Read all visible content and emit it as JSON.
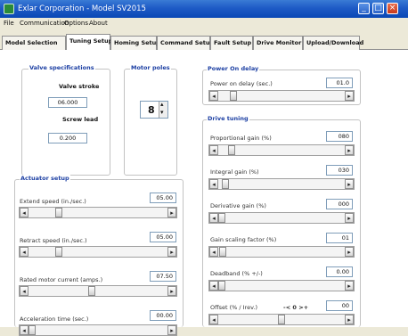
{
  "window": {
    "title": "Exlar Corporation - Model SV2015",
    "min": "_",
    "max": "□",
    "close": "×"
  },
  "menu": [
    "File",
    "Communication",
    "Options",
    "About"
  ],
  "tabs": [
    "Model Selection",
    "Tuning Setup",
    "Homing Setup",
    "Command Setup",
    "Fault Setup",
    "Drive Monitor",
    "Upload/Download"
  ],
  "active_tab": "Tuning Setup",
  "valve_specs": {
    "title": "Valve specifications",
    "stroke_label": "Valve stroke",
    "stroke_value": "06.000",
    "lead_label": "Screw lead",
    "lead_value": "0.200"
  },
  "motor_poles": {
    "title": "Motor poles",
    "value": "8"
  },
  "actuator": {
    "title": "Actuator setup",
    "rows": [
      {
        "label": "Extend speed (in./sec.)",
        "value": "05.00",
        "level": 0.2
      },
      {
        "label": "Retract speed (in./sec.)",
        "value": "05.00",
        "level": 0.2
      },
      {
        "label": "Rated motor current (amps.)",
        "value": "07.50",
        "level": 0.45
      },
      {
        "label": "Acceleration time (sec.)",
        "value": "00.00",
        "level": 0.0
      }
    ]
  },
  "power_on": {
    "title": "Power On delay",
    "label": "Power on delay (sec.)",
    "value": "01.0",
    "level": 0.1
  },
  "drive_tuning": {
    "title": "Drive tuning",
    "rows": [
      {
        "label": "Proportional gain (%)",
        "value": "080",
        "level": 0.08
      },
      {
        "label": "Integral gain (%)",
        "value": "030",
        "level": 0.03
      },
      {
        "label": "Derivative gain (%)",
        "value": "000",
        "level": 0.0
      },
      {
        "label": "Gain scaling factor (%)",
        "value": "01",
        "level": 0.01
      },
      {
        "label": "Deadband (% +/-)",
        "value": "0.00",
        "level": 0.0
      },
      {
        "label": "Offset (% / Irev.)",
        "value": "00",
        "level": 0.5,
        "extra": "-< 0 >+"
      }
    ]
  },
  "icons": {
    "left_arrow": "◂",
    "right_arrow": "▸",
    "spin_up": "▴",
    "spin_down": "▾"
  }
}
